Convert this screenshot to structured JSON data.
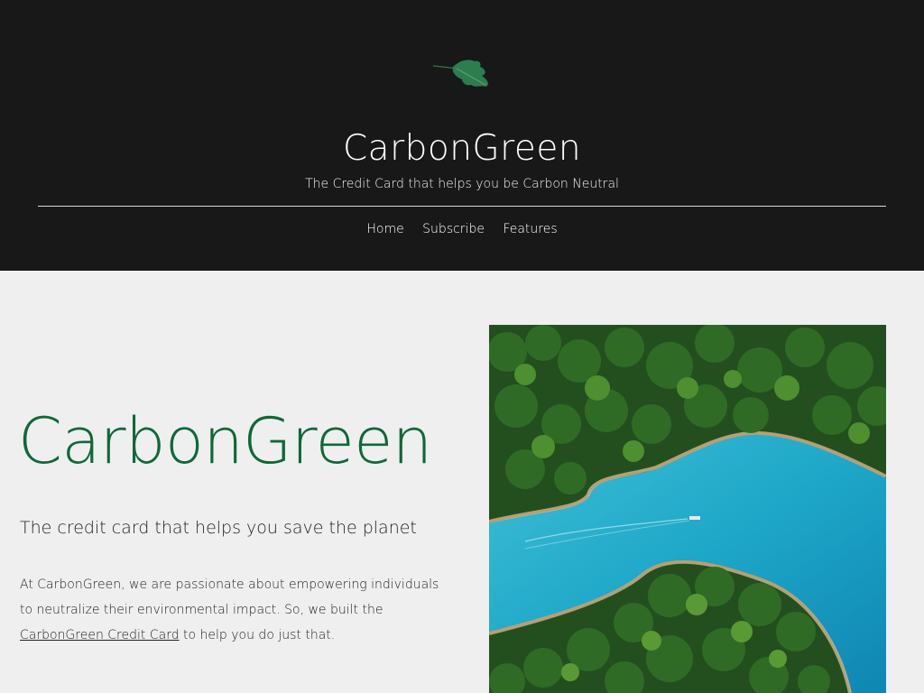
{
  "header": {
    "logo_icon": "leaf-icon",
    "site_title": "CarbonGreen",
    "tagline": "The Credit Card that helps you be Carbon Neutral",
    "nav": [
      {
        "label": "Home"
      },
      {
        "label": "Subscribe"
      },
      {
        "label": "Features"
      }
    ]
  },
  "hero": {
    "title": "CarbonGreen",
    "subtitle": "The credit card that helps you save the planet",
    "paragraph_before_link": "At CarbonGreen, we are passionate about empowering individuals to neutralize their environmental impact. So, we built the ",
    "link_text": "CarbonGreen Credit Card",
    "paragraph_after_link": " to help you do just that.",
    "image_icon": "forest-lake-aerial-photo"
  },
  "colors": {
    "header_bg": "#181818",
    "page_bg": "#efefef",
    "accent_green": "#0f6838",
    "water": "#2aa9c9"
  }
}
